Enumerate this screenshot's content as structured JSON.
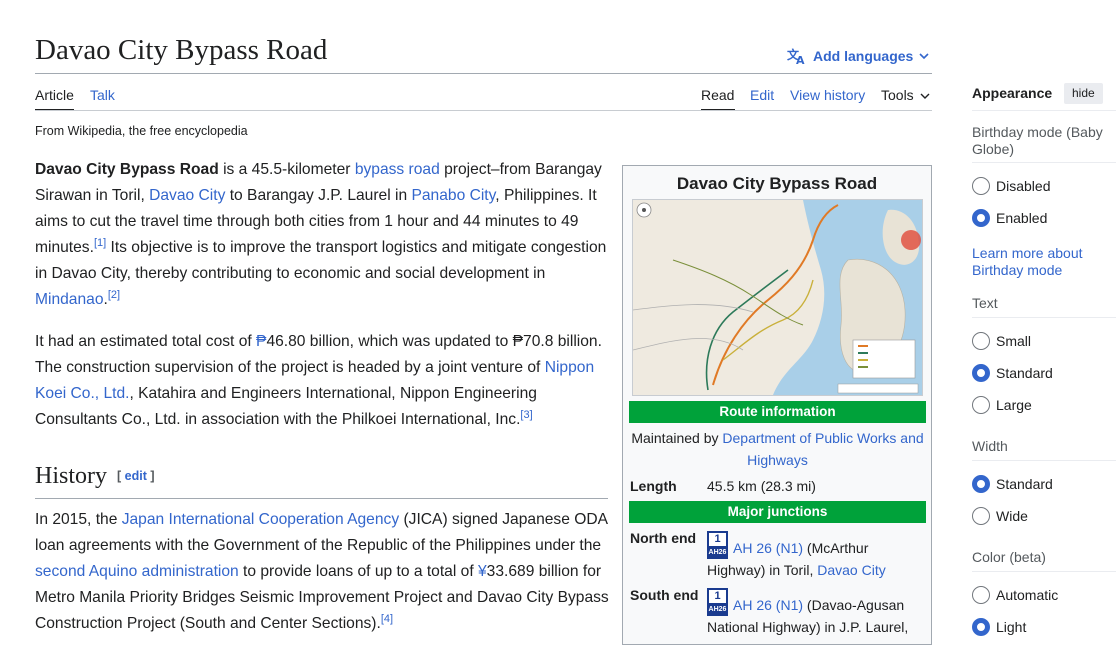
{
  "page": {
    "title": "Davao City Bypass Road",
    "add_languages": "Add languages",
    "tagline": "From Wikipedia, the free encyclopedia"
  },
  "tabs": {
    "article": "Article",
    "talk": "Talk",
    "read": "Read",
    "edit": "Edit",
    "view_history": "View history",
    "tools": "Tools"
  },
  "body": {
    "p1": {
      "bold": "Davao City Bypass Road",
      "t1": " is a 45.5-kilometer ",
      "l1": "bypass road",
      "t2": " project–from Barangay Sirawan in Toril, ",
      "l2": "Davao City",
      "t3": " to Barangay J.P. Laurel in ",
      "l3": "Panabo City",
      "t4": ", Philippines. It aims to cut the travel time through both cities from 1 hour and 44 minutes to 49 minutes.",
      "ref1": "[1]",
      "t5": " Its objective is to improve the transport logistics and mitigate congestion in Davao City, thereby contributing to economic and social development in ",
      "l4": "Mindanao",
      "t6": ".",
      "ref2": "[2]"
    },
    "p2": {
      "t1": "It had an estimated total cost of ",
      "l1": "₱",
      "t2": "46.80 billion, which was updated to ₱70.8 billion. The construction supervision of the project is headed by a joint venture of ",
      "l2": "Nippon Koei Co., Ltd.",
      "t3": ", Katahira and Engineers International, Nippon Engineering Consultants Co., Ltd. in association with the Philkoei International, Inc.",
      "ref3": "[3]"
    },
    "history_heading": "History",
    "history_edit": "edit",
    "p3": {
      "t1": "In 2015, the ",
      "l1": "Japan International Cooperation Agency",
      "t2": " (JICA) signed Japanese ODA loan agreements with the Government of the Republic of the Philippines under the ",
      "l2": "second Aquino administration",
      "t3": " to provide loans of up to a total of ",
      "l3": "¥",
      "t4": "33.689 billion for Metro Manila Priority Bridges Seismic Improvement Project and Davao City Bypass Construction Project (South and Center Sections).",
      "ref4": "[4]"
    }
  },
  "infobox": {
    "title": "Davao City Bypass Road",
    "route_info": "Route information",
    "maintained_prefix": "Maintained by ",
    "maintained_link": "Department of Public Works and Highways",
    "length_label": "Length",
    "length_value": "45.5 km (28.3 mi)",
    "major_junctions": "Major junctions",
    "north_label": "North end",
    "north_link": "AH 26 (N1)",
    "north_text": " (McArthur Highway) in Toril, ",
    "north_link2": "Davao City",
    "south_label": "South end",
    "south_link": "AH 26 (N1)",
    "south_text": " (Davao-Agusan National Highway) in J.P. Laurel,",
    "shield_top": "1",
    "shield_bottom": "AH26"
  },
  "appearance": {
    "title": "Appearance",
    "hide": "hide",
    "birthday_heading": "Birthday mode (Baby Globe)",
    "birthday_options": [
      "Disabled",
      "Enabled"
    ],
    "birthday_selected": "Enabled",
    "birthday_link": "Learn more about Birthday mode",
    "text_heading": "Text",
    "text_options": [
      "Small",
      "Standard",
      "Large"
    ],
    "text_selected": "Standard",
    "width_heading": "Width",
    "width_options": [
      "Standard",
      "Wide"
    ],
    "width_selected": "Standard",
    "color_heading": "Color (beta)",
    "color_options": [
      "Automatic",
      "Light"
    ],
    "color_selected": "Light"
  },
  "colors": {
    "link": "#3366cc",
    "infobox_header": "#00a23a",
    "text": "#202122"
  }
}
